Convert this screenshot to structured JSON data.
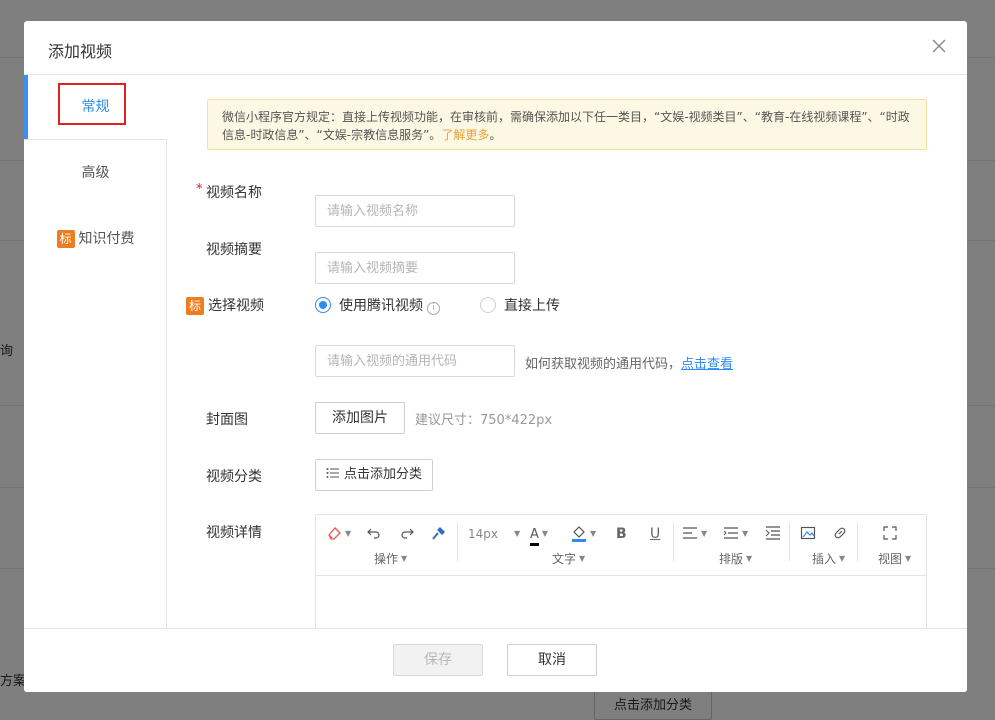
{
  "background": {
    "left_text_1": "询",
    "left_text_2": "方案",
    "bottom_button": "点击添加分类"
  },
  "dialog": {
    "title": "添加视频",
    "close_label": "X"
  },
  "sidebar": {
    "items": [
      {
        "label": "常规",
        "active": true
      },
      {
        "label": "高级"
      },
      {
        "label": "知识付费",
        "tag": "标"
      }
    ]
  },
  "notice": {
    "text": "微信小程序官方规定：直接上传视频功能，在审核前，需确保添加以下任一类目，“文娱-视频类目”、“教育-在线视频课程”、“时政信息-时政信息”、“文娱-宗教信息服务”。",
    "link": "了解更多",
    "end": "。"
  },
  "form": {
    "name_label": "视频名称",
    "name_required": "*",
    "name_placeholder": "请输入视频名称",
    "summary_label": "视频摘要",
    "summary_placeholder": "请输入视频摘要",
    "select_tag": "标",
    "select_label": "选择视频",
    "radio_tencent": "使用腾讯视频",
    "radio_upload": "直接上传",
    "code_placeholder": "请输入视频的通用代码",
    "code_hint": "如何获取视频的通用代码，",
    "code_link": "点击查看",
    "cover_label": "封面图",
    "cover_button": "添加图片",
    "cover_hint": "建议尺寸：750*422px",
    "category_label": "视频分类",
    "category_button": "点击添加分类",
    "detail_label": "视频详情"
  },
  "editor": {
    "font_size": "14px",
    "groups": [
      {
        "label": "操作"
      },
      {
        "label": "文字"
      },
      {
        "label": "排版"
      },
      {
        "label": "插入"
      },
      {
        "label": "视图"
      }
    ],
    "bold": "B",
    "underline": "U",
    "font_color_glyph": "A"
  },
  "footer": {
    "save": "保存",
    "cancel": "取消"
  },
  "colors": {
    "accent": "#2d8cf0",
    "tag": "#ee7d1f",
    "required": "#e02020",
    "notice_bg": "#fdf8e4",
    "notice_link": "#e6a23c"
  }
}
